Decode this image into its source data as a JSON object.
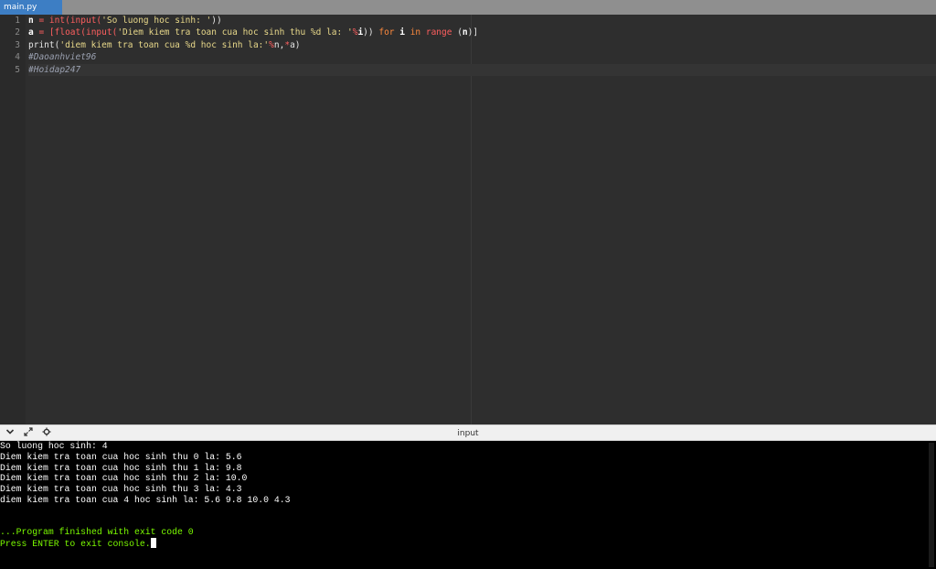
{
  "tabs": [
    {
      "label": "main.py",
      "active": true
    }
  ],
  "editor": {
    "line_numbers": [
      "1",
      "2",
      "3",
      "4",
      "5"
    ],
    "lines": [
      [
        {
          "t": "n",
          "c": "var"
        },
        {
          "t": " = ",
          "c": "fn"
        },
        {
          "t": "int",
          "c": "fn"
        },
        {
          "t": "(",
          "c": "fn"
        },
        {
          "t": "input",
          "c": "fn"
        },
        {
          "t": "(",
          "c": "fn"
        },
        {
          "t": "'So luong hoc sinh: '",
          "c": "str"
        },
        {
          "t": "))",
          "c": "plain"
        }
      ],
      [
        {
          "t": "a",
          "c": "var"
        },
        {
          "t": " = [",
          "c": "fn"
        },
        {
          "t": "float",
          "c": "fn"
        },
        {
          "t": "(",
          "c": "fn"
        },
        {
          "t": "input",
          "c": "fn"
        },
        {
          "t": "(",
          "c": "fn"
        },
        {
          "t": "'Diem kiem tra toan cua hoc sinh thu %d la: '",
          "c": "str"
        },
        {
          "t": "%",
          "c": "fn"
        },
        {
          "t": "i",
          "c": "var"
        },
        {
          "t": ")) ",
          "c": "plain"
        },
        {
          "t": "for",
          "c": "kw"
        },
        {
          "t": " i ",
          "c": "var"
        },
        {
          "t": "in",
          "c": "kw"
        },
        {
          "t": " range",
          "c": "fn"
        },
        {
          "t": " (",
          "c": "plain"
        },
        {
          "t": "n",
          "c": "var"
        },
        {
          "t": ")]",
          "c": "plain"
        }
      ],
      [
        {
          "t": "print",
          "c": "plain"
        },
        {
          "t": "(",
          "c": "plain"
        },
        {
          "t": "'diem kiem tra toan cua %d hoc sinh la:'",
          "c": "str"
        },
        {
          "t": "%",
          "c": "fn"
        },
        {
          "t": "n",
          "c": "plain"
        },
        {
          "t": ",",
          "c": "plain"
        },
        {
          "t": "*",
          "c": "fn"
        },
        {
          "t": "a",
          "c": "plain"
        },
        {
          "t": ")",
          "c": "plain"
        }
      ],
      [
        {
          "t": "#Daoanhviet96",
          "c": "cmt"
        }
      ],
      [
        {
          "t": "#Hoidap247",
          "c": "cmt"
        }
      ]
    ]
  },
  "console": {
    "title": "input",
    "icons": [
      "chevron-down-icon",
      "expand-icon",
      "settings-icon"
    ],
    "output_lines": [
      {
        "text": "So luong hoc sinh: 4",
        "color": "white"
      },
      {
        "text": "Diem kiem tra toan cua hoc sinh thu 0 la: 5.6",
        "color": "white"
      },
      {
        "text": "Diem kiem tra toan cua hoc sinh thu 1 la: 9.8",
        "color": "white"
      },
      {
        "text": "Diem kiem tra toan cua hoc sinh thu 2 la: 10.0",
        "color": "white"
      },
      {
        "text": "Diem kiem tra toan cua hoc sinh thu 3 la: 4.3",
        "color": "white"
      },
      {
        "text": "diem kiem tra toan cua 4 hoc sinh la: 5.6 9.8 10.0 4.3",
        "color": "white"
      },
      {
        "text": "",
        "color": "white"
      },
      {
        "text": "",
        "color": "white"
      },
      {
        "text": "...Program finished with exit code 0",
        "color": "green"
      },
      {
        "text": "Press ENTER to exit console.",
        "color": "green"
      }
    ]
  },
  "colors": {
    "tab_active": "#3d7ec4",
    "editor_bg": "#2e2e2e",
    "console_bg": "#000000",
    "console_green": "#7cfc00"
  }
}
